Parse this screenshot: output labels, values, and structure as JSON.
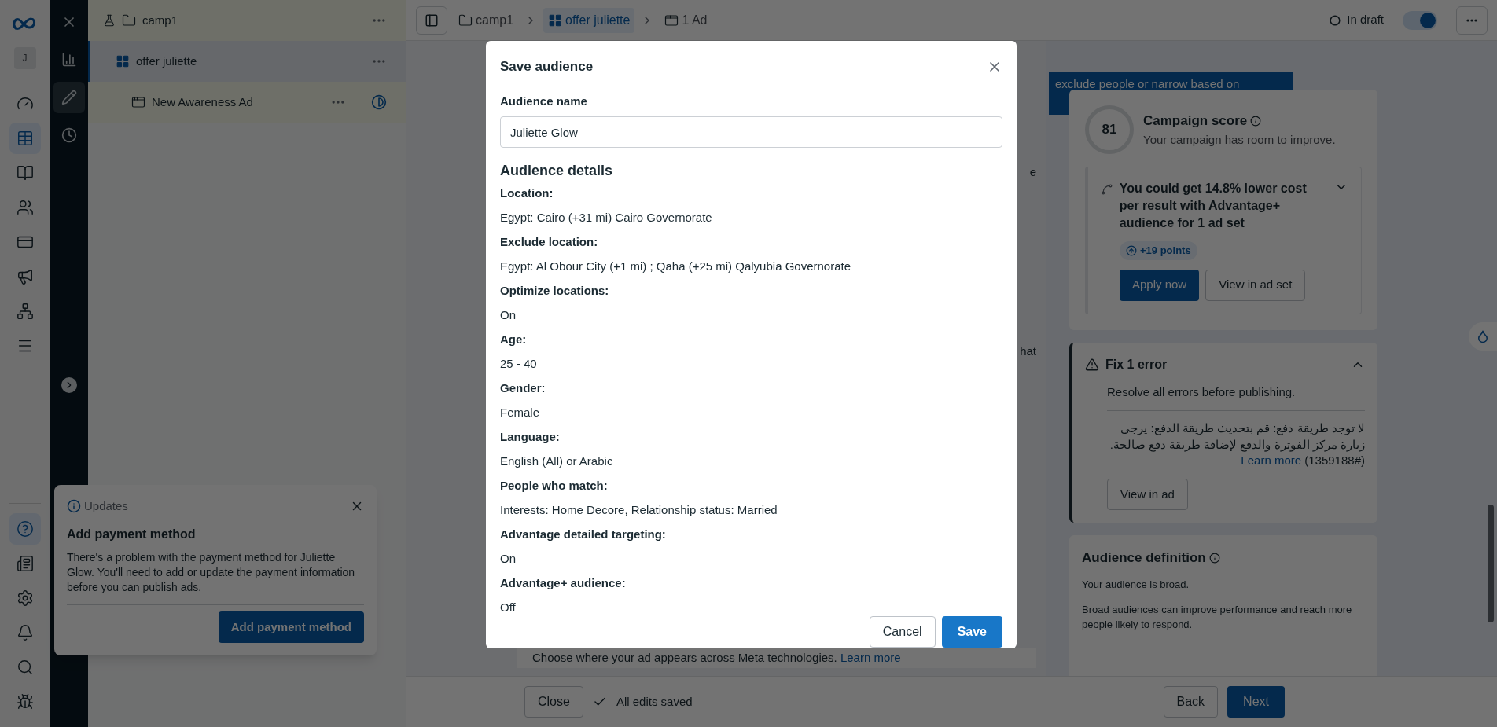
{
  "rail": {
    "avatar": "J",
    "items": [
      {
        "kind": "dashboard",
        "selected": false
      },
      {
        "kind": "table",
        "selected": true
      },
      {
        "kind": "pages",
        "selected": false
      },
      {
        "kind": "people",
        "selected": false
      },
      {
        "kind": "card",
        "selected": false
      },
      {
        "kind": "megaphone",
        "selected": false
      },
      {
        "kind": "network",
        "selected": false
      },
      {
        "kind": "menu",
        "selected": false
      }
    ],
    "bottom": [
      {
        "kind": "help",
        "selected": true
      },
      {
        "kind": "news",
        "selected": false
      },
      {
        "kind": "settings",
        "selected": false
      },
      {
        "kind": "bell",
        "selected": false
      },
      {
        "kind": "search",
        "selected": false
      },
      {
        "kind": "bug",
        "selected": false
      }
    ]
  },
  "tools": [
    {
      "kind": "close",
      "selected": false
    },
    {
      "kind": "chart",
      "selected": false
    },
    {
      "kind": "edit",
      "selected": true
    },
    {
      "kind": "history",
      "selected": false
    }
  ],
  "tree": [
    {
      "label": "camp1",
      "kind": "campaign",
      "selected": false
    },
    {
      "label": "offer juliette",
      "kind": "adset",
      "selected": true
    },
    {
      "label": "New Awareness Ad",
      "kind": "ad",
      "selected": false
    }
  ],
  "breadcrumbs": [
    {
      "label": "camp1",
      "kind": "campaign",
      "selected": false
    },
    {
      "label": "offer juliette",
      "kind": "adset",
      "selected": true
    },
    {
      "label": "1 Ad",
      "kind": "ad",
      "selected": false
    }
  ],
  "status": {
    "label": "In draft",
    "toggle_on": true
  },
  "tooltip_fragment": "exclude people or narrow based on",
  "background_fragments": [
    "e",
    "hat"
  ],
  "placements": {
    "text": "Choose where your ad appears across Meta technologies.",
    "link": "Learn more"
  },
  "footer": {
    "close": "Close",
    "saved": "All edits saved",
    "back": "Back",
    "next": "Next"
  },
  "score": {
    "value": "81",
    "title": "Campaign score",
    "subtitle": "Your campaign has room to improve."
  },
  "recommendation": {
    "text": "You could get 14.8% lower cost per result with Advantage+ audience for 1 ad set",
    "points": "+19 points",
    "apply": "Apply now",
    "view": "View in ad set",
    "expanded": false
  },
  "error": {
    "title": "Fix 1 error",
    "subtitle": "Resolve all errors before publishing.",
    "message": "لا توجد طريقة دفع: قم بتحديث طريقة الدفع: يرجى زيارة مركز الفوترة والدفع لإضافة طريقة دفع صالحة. (#1359188)",
    "link": "Learn more",
    "button": "View in ad",
    "expanded": true
  },
  "audience_definition": {
    "title": "Audience definition",
    "lines": [
      "Your audience is broad.",
      "Broad audiences can improve performance and reach more people likely to respond."
    ]
  },
  "updates": {
    "label": "Updates",
    "title": "Add payment method",
    "body": "There's a problem with the payment method for Juliette Glow. You'll need to add or update the payment information before you can publish ads.",
    "button": "Add payment method"
  },
  "modal": {
    "title": "Save audience",
    "name_label": "Audience name",
    "name_value": "Juliette Glow",
    "details_heading": "Audience details",
    "details": [
      {
        "label": "Location:",
        "value": "Egypt: Cairo (+31 mi) Cairo Governorate"
      },
      {
        "label": "Exclude location:",
        "value": "Egypt: Al Obour City (+1 mi) ; Qaha (+25 mi) Qalyubia Governorate"
      },
      {
        "label": "Optimize locations:",
        "value": "On"
      },
      {
        "label": "Age:",
        "value": "25 - 40"
      },
      {
        "label": "Gender:",
        "value": "Female"
      },
      {
        "label": "Language:",
        "value": "English (All) or Arabic"
      },
      {
        "label": "People who match:",
        "value": "Interests: Home Decore, Relationship status: Married"
      },
      {
        "label": "Advantage detailed targeting:",
        "value": "On"
      },
      {
        "label": "Advantage+ audience:",
        "value": "Off"
      }
    ],
    "cancel": "Cancel",
    "save": "Save"
  }
}
